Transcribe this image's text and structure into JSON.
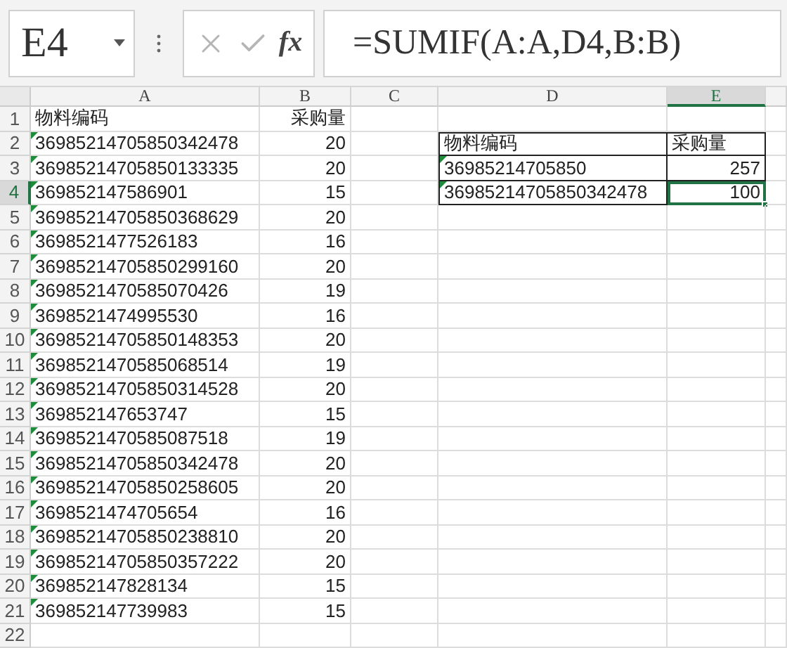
{
  "name_box": "E4",
  "formula_bar": {
    "function_label": "fx",
    "formula": "=SUMIF(A:A,D4,B:B)"
  },
  "columns": [
    {
      "label": "A",
      "selected": false
    },
    {
      "label": "B",
      "selected": false
    },
    {
      "label": "C",
      "selected": false
    },
    {
      "label": "D",
      "selected": false
    },
    {
      "label": "E",
      "selected": true
    }
  ],
  "rows": [
    {
      "number": "1",
      "selected": false,
      "a": {
        "text": "物料编码"
      },
      "b": {
        "text": "采购量"
      }
    },
    {
      "number": "2",
      "selected": false,
      "a": {
        "text": "36985214705850342478",
        "flagged": true
      },
      "b": {
        "text": "20"
      },
      "d": {
        "text": "物料编码",
        "bordered": true
      },
      "e": {
        "text": "采购量",
        "bordered": true,
        "selected": false,
        "kind": "text"
      }
    },
    {
      "number": "3",
      "selected": false,
      "a": {
        "text": "36985214705850133335",
        "flagged": true
      },
      "b": {
        "text": "20"
      },
      "d": {
        "text": "36985214705850",
        "flagged": true,
        "bordered": true
      },
      "e": {
        "text": "257",
        "bordered": true,
        "selected": false,
        "kind": "number"
      }
    },
    {
      "number": "4",
      "selected": true,
      "a": {
        "text": "369852147586901",
        "flagged": true
      },
      "b": {
        "text": "15"
      },
      "d": {
        "text": "36985214705850342478",
        "flagged": true,
        "bordered": true
      },
      "e": {
        "text": "100",
        "bordered": true,
        "selected": true,
        "kind": "number"
      }
    },
    {
      "number": "5",
      "selected": false,
      "a": {
        "text": "36985214705850368629",
        "flagged": true
      },
      "b": {
        "text": "20"
      }
    },
    {
      "number": "6",
      "selected": false,
      "a": {
        "text": "3698521477526183",
        "flagged": true
      },
      "b": {
        "text": "16"
      }
    },
    {
      "number": "7",
      "selected": false,
      "a": {
        "text": "36985214705850299160",
        "flagged": true
      },
      "b": {
        "text": "20"
      }
    },
    {
      "number": "8",
      "selected": false,
      "a": {
        "text": "3698521470585070426",
        "flagged": true
      },
      "b": {
        "text": "19"
      }
    },
    {
      "number": "9",
      "selected": false,
      "a": {
        "text": "3698521474995530",
        "flagged": true
      },
      "b": {
        "text": "16"
      }
    },
    {
      "number": "10",
      "selected": false,
      "a": {
        "text": "36985214705850148353",
        "flagged": true
      },
      "b": {
        "text": "20"
      }
    },
    {
      "number": "11",
      "selected": false,
      "a": {
        "text": "3698521470585068514",
        "flagged": true
      },
      "b": {
        "text": "19"
      }
    },
    {
      "number": "12",
      "selected": false,
      "a": {
        "text": "36985214705850314528",
        "flagged": true
      },
      "b": {
        "text": "20"
      }
    },
    {
      "number": "13",
      "selected": false,
      "a": {
        "text": "369852147653747",
        "flagged": true
      },
      "b": {
        "text": "15"
      }
    },
    {
      "number": "14",
      "selected": false,
      "a": {
        "text": "3698521470585087518",
        "flagged": true
      },
      "b": {
        "text": "19"
      }
    },
    {
      "number": "15",
      "selected": false,
      "a": {
        "text": "36985214705850342478",
        "flagged": true
      },
      "b": {
        "text": "20"
      }
    },
    {
      "number": "16",
      "selected": false,
      "a": {
        "text": "36985214705850258605",
        "flagged": true
      },
      "b": {
        "text": "20"
      }
    },
    {
      "number": "17",
      "selected": false,
      "a": {
        "text": "3698521474705654",
        "flagged": true
      },
      "b": {
        "text": "16"
      }
    },
    {
      "number": "18",
      "selected": false,
      "a": {
        "text": "36985214705850238810",
        "flagged": true
      },
      "b": {
        "text": "20"
      }
    },
    {
      "number": "19",
      "selected": false,
      "a": {
        "text": "36985214705850357222",
        "flagged": true
      },
      "b": {
        "text": "20"
      }
    },
    {
      "number": "20",
      "selected": false,
      "a": {
        "text": "369852147828134",
        "flagged": true
      },
      "b": {
        "text": "15"
      }
    },
    {
      "number": "21",
      "selected": false,
      "a": {
        "text": "369852147739983",
        "flagged": true
      },
      "b": {
        "text": "15"
      }
    },
    {
      "number": "22",
      "selected": false
    }
  ]
}
